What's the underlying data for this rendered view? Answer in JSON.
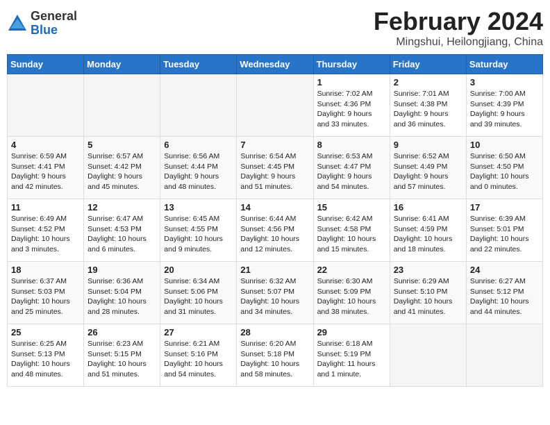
{
  "logo": {
    "general": "General",
    "blue": "Blue"
  },
  "title": "February 2024",
  "subtitle": "Mingshui, Heilongjiang, China",
  "headers": [
    "Sunday",
    "Monday",
    "Tuesday",
    "Wednesday",
    "Thursday",
    "Friday",
    "Saturday"
  ],
  "weeks": [
    [
      {
        "day": "",
        "info": ""
      },
      {
        "day": "",
        "info": ""
      },
      {
        "day": "",
        "info": ""
      },
      {
        "day": "",
        "info": ""
      },
      {
        "day": "1",
        "info": "Sunrise: 7:02 AM\nSunset: 4:36 PM\nDaylight: 9 hours\nand 33 minutes."
      },
      {
        "day": "2",
        "info": "Sunrise: 7:01 AM\nSunset: 4:38 PM\nDaylight: 9 hours\nand 36 minutes."
      },
      {
        "day": "3",
        "info": "Sunrise: 7:00 AM\nSunset: 4:39 PM\nDaylight: 9 hours\nand 39 minutes."
      }
    ],
    [
      {
        "day": "4",
        "info": "Sunrise: 6:59 AM\nSunset: 4:41 PM\nDaylight: 9 hours\nand 42 minutes."
      },
      {
        "day": "5",
        "info": "Sunrise: 6:57 AM\nSunset: 4:42 PM\nDaylight: 9 hours\nand 45 minutes."
      },
      {
        "day": "6",
        "info": "Sunrise: 6:56 AM\nSunset: 4:44 PM\nDaylight: 9 hours\nand 48 minutes."
      },
      {
        "day": "7",
        "info": "Sunrise: 6:54 AM\nSunset: 4:45 PM\nDaylight: 9 hours\nand 51 minutes."
      },
      {
        "day": "8",
        "info": "Sunrise: 6:53 AM\nSunset: 4:47 PM\nDaylight: 9 hours\nand 54 minutes."
      },
      {
        "day": "9",
        "info": "Sunrise: 6:52 AM\nSunset: 4:49 PM\nDaylight: 9 hours\nand 57 minutes."
      },
      {
        "day": "10",
        "info": "Sunrise: 6:50 AM\nSunset: 4:50 PM\nDaylight: 10 hours\nand 0 minutes."
      }
    ],
    [
      {
        "day": "11",
        "info": "Sunrise: 6:49 AM\nSunset: 4:52 PM\nDaylight: 10 hours\nand 3 minutes."
      },
      {
        "day": "12",
        "info": "Sunrise: 6:47 AM\nSunset: 4:53 PM\nDaylight: 10 hours\nand 6 minutes."
      },
      {
        "day": "13",
        "info": "Sunrise: 6:45 AM\nSunset: 4:55 PM\nDaylight: 10 hours\nand 9 minutes."
      },
      {
        "day": "14",
        "info": "Sunrise: 6:44 AM\nSunset: 4:56 PM\nDaylight: 10 hours\nand 12 minutes."
      },
      {
        "day": "15",
        "info": "Sunrise: 6:42 AM\nSunset: 4:58 PM\nDaylight: 10 hours\nand 15 minutes."
      },
      {
        "day": "16",
        "info": "Sunrise: 6:41 AM\nSunset: 4:59 PM\nDaylight: 10 hours\nand 18 minutes."
      },
      {
        "day": "17",
        "info": "Sunrise: 6:39 AM\nSunset: 5:01 PM\nDaylight: 10 hours\nand 22 minutes."
      }
    ],
    [
      {
        "day": "18",
        "info": "Sunrise: 6:37 AM\nSunset: 5:03 PM\nDaylight: 10 hours\nand 25 minutes."
      },
      {
        "day": "19",
        "info": "Sunrise: 6:36 AM\nSunset: 5:04 PM\nDaylight: 10 hours\nand 28 minutes."
      },
      {
        "day": "20",
        "info": "Sunrise: 6:34 AM\nSunset: 5:06 PM\nDaylight: 10 hours\nand 31 minutes."
      },
      {
        "day": "21",
        "info": "Sunrise: 6:32 AM\nSunset: 5:07 PM\nDaylight: 10 hours\nand 34 minutes."
      },
      {
        "day": "22",
        "info": "Sunrise: 6:30 AM\nSunset: 5:09 PM\nDaylight: 10 hours\nand 38 minutes."
      },
      {
        "day": "23",
        "info": "Sunrise: 6:29 AM\nSunset: 5:10 PM\nDaylight: 10 hours\nand 41 minutes."
      },
      {
        "day": "24",
        "info": "Sunrise: 6:27 AM\nSunset: 5:12 PM\nDaylight: 10 hours\nand 44 minutes."
      }
    ],
    [
      {
        "day": "25",
        "info": "Sunrise: 6:25 AM\nSunset: 5:13 PM\nDaylight: 10 hours\nand 48 minutes."
      },
      {
        "day": "26",
        "info": "Sunrise: 6:23 AM\nSunset: 5:15 PM\nDaylight: 10 hours\nand 51 minutes."
      },
      {
        "day": "27",
        "info": "Sunrise: 6:21 AM\nSunset: 5:16 PM\nDaylight: 10 hours\nand 54 minutes."
      },
      {
        "day": "28",
        "info": "Sunrise: 6:20 AM\nSunset: 5:18 PM\nDaylight: 10 hours\nand 58 minutes."
      },
      {
        "day": "29",
        "info": "Sunrise: 6:18 AM\nSunset: 5:19 PM\nDaylight: 11 hours\nand 1 minute."
      },
      {
        "day": "",
        "info": ""
      },
      {
        "day": "",
        "info": ""
      }
    ]
  ]
}
